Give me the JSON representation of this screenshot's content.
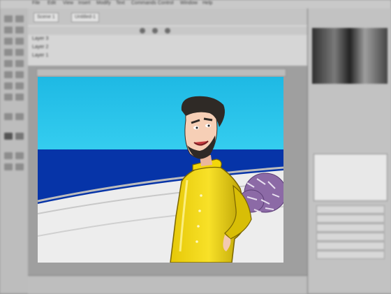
{
  "window": {
    "menu": [
      "File",
      "Edit",
      "View",
      "Insert",
      "Modify",
      "Text",
      "Commands",
      "Control",
      "Window",
      "Help"
    ],
    "doc_tabs": [
      "Scene 1",
      "Untitled-1"
    ]
  },
  "timeline": {
    "layers": [
      "Layer 3",
      "Layer 2",
      "Layer 1"
    ],
    "frame_readout": ""
  },
  "library_panel": {
    "items": [
      "",
      "",
      "",
      "",
      "",
      ""
    ]
  },
  "status_bar": {
    "zoom": "",
    "fps": ""
  },
  "colors": {
    "sky": "#25c6ea",
    "sea": "#0634a8",
    "raincoat": "#f2d60b",
    "hair": "#2f2a26"
  }
}
